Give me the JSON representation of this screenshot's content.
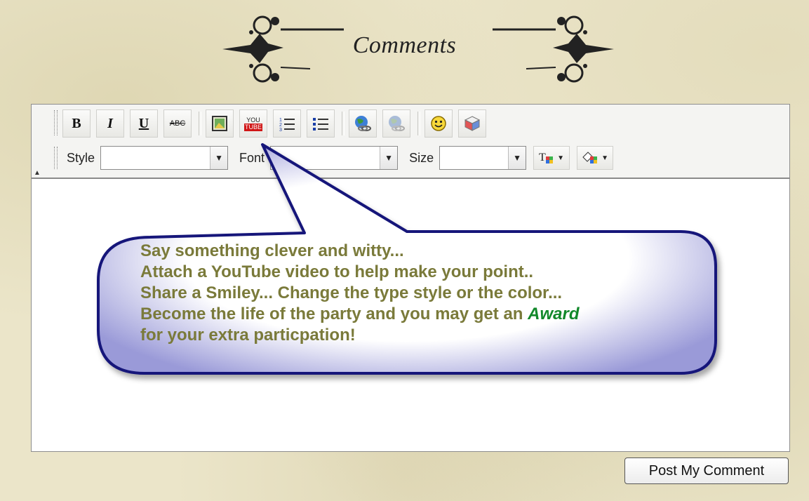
{
  "header": {
    "title": "Comments"
  },
  "toolbar": {
    "row1_buttons": [
      {
        "name": "bold-button",
        "label": "B"
      },
      {
        "name": "italic-button",
        "label": "I"
      },
      {
        "name": "underline-button",
        "label": "U"
      },
      {
        "name": "strikethrough-button",
        "label": "ABC"
      }
    ],
    "style_label": "Style",
    "font_label": "Font",
    "size_label": "Size",
    "style_value": "",
    "font_value": "",
    "size_value": "",
    "youtube_icon_top": "YOU",
    "youtube_icon_bottom": "TUBE"
  },
  "callout": {
    "line1": "Say something clever and witty...",
    "line2": "Attach a YouTube video to help make your point..",
    "line3": "Share a Smiley... Change the type style or the color...",
    "line4_before": "Become the life of the party and you may get an ",
    "line4_award": "Award",
    "line5": "for your extra particpation!"
  },
  "submit_label": "Post My Comment",
  "colors": {
    "callout_text": "#7a7a3a",
    "award": "#11882a",
    "bubble_border": "#12127a",
    "background": "#ebe5c9"
  }
}
